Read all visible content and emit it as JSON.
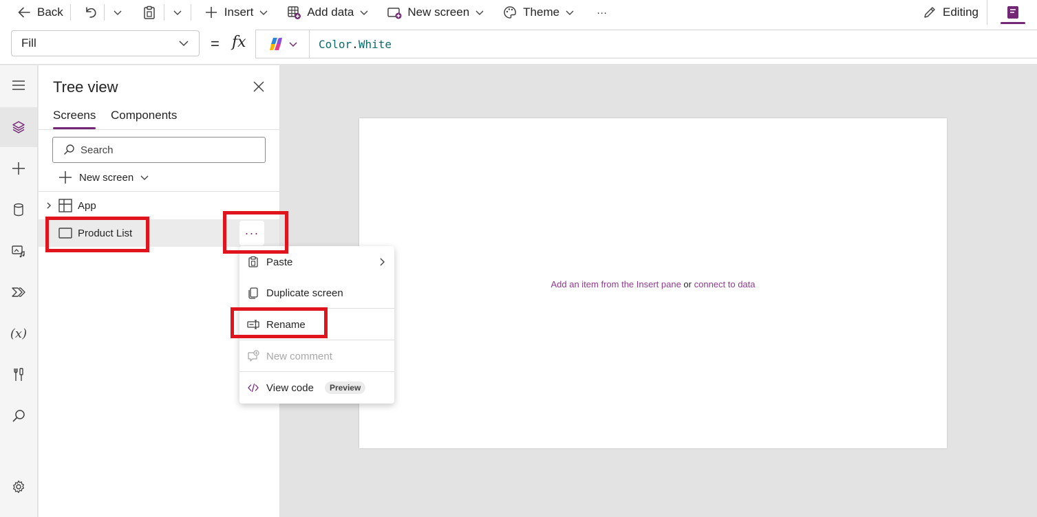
{
  "toolbar": {
    "back_label": "Back",
    "insert_label": "Insert",
    "add_data_label": "Add data",
    "new_screen_label": "New screen",
    "theme_label": "Theme",
    "more_label": "···",
    "editing_label": "Editing"
  },
  "formula_bar": {
    "property": "Fill",
    "equals": "=",
    "fx": "fx",
    "formula_obj": "Color",
    "formula_dot": ".",
    "formula_member": "White"
  },
  "tree_view": {
    "title": "Tree view",
    "tabs": [
      "Screens",
      "Components"
    ],
    "search_placeholder": "Search",
    "new_screen_label": "New screen",
    "nodes": [
      {
        "label": "App"
      },
      {
        "label": "Product List"
      }
    ],
    "more_label": "···"
  },
  "context_menu": {
    "items": [
      {
        "label": "Paste"
      },
      {
        "label": "Duplicate screen"
      },
      {
        "label": "Rename"
      },
      {
        "label": "New comment"
      },
      {
        "label": "View code",
        "badge": "Preview"
      }
    ]
  },
  "canvas": {
    "hint_link1": "Add an item from the Insert pane",
    "hint_or": " or ",
    "hint_link2": "connect to data"
  },
  "colors": {
    "accent": "#742774",
    "highlight": "#e0141c",
    "link": "#8f3a8f"
  }
}
